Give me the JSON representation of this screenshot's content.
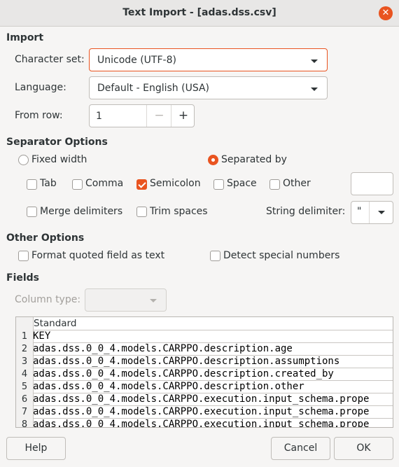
{
  "window": {
    "title": "Text Import - [adas.dss.csv]",
    "close_glyph": "✕"
  },
  "import": {
    "section_label": "Import",
    "charset_label": "Character set:",
    "charset_value": "Unicode (UTF-8)",
    "language_label": "Language:",
    "language_value": "Default - English (USA)",
    "from_row_label": "From row:",
    "from_row_value": "1",
    "minus": "−",
    "plus": "+"
  },
  "separator": {
    "section_label": "Separator Options",
    "fixed_width": "Fixed width",
    "separated_by": "Separated by",
    "tab": "Tab",
    "comma": "Comma",
    "semicolon": "Semicolon",
    "space": "Space",
    "other": "Other",
    "merge": "Merge delimiters",
    "trim": "Trim spaces",
    "string_delimiter_label": "String delimiter:",
    "string_delimiter_value": "\""
  },
  "other_options": {
    "section_label": "Other Options",
    "format_quoted": "Format quoted field as text",
    "detect_special": "Detect special numbers"
  },
  "fields": {
    "section_label": "Fields",
    "column_type_label": "Column type:",
    "column_header": "Standard",
    "rows": [
      {
        "n": "1",
        "v": "KEY"
      },
      {
        "n": "2",
        "v": "adas.dss.0_0_4.models.CARPPO.description.age"
      },
      {
        "n": "3",
        "v": "adas.dss.0_0_4.models.CARPPO.description.assumptions"
      },
      {
        "n": "4",
        "v": "adas.dss.0_0_4.models.CARPPO.description.created_by"
      },
      {
        "n": "5",
        "v": "adas.dss.0_0_4.models.CARPPO.description.other"
      },
      {
        "n": "6",
        "v": "adas.dss.0_0_4.models.CARPPO.execution.input_schema.prope"
      },
      {
        "n": "7",
        "v": "adas.dss.0_0_4.models.CARPPO.execution.input_schema.prope"
      },
      {
        "n": "8",
        "v": "adas.dss.0_0_4.models.CARPPO.execution.input_schema.prope"
      }
    ]
  },
  "buttons": {
    "help": "Help",
    "cancel": "Cancel",
    "ok": "OK"
  },
  "colors": {
    "accent": "#e95420",
    "background": "#f6f5f4"
  }
}
